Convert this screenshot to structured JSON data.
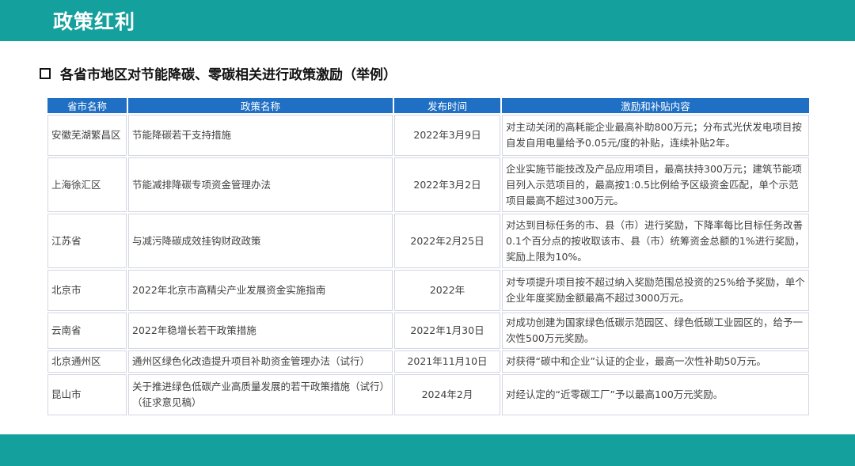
{
  "header": {
    "title": "政策红利"
  },
  "subtitle": "各省市地区对节能降碳、零碳相关进行政策激励（举例）",
  "table": {
    "columns": [
      "省市名称",
      "政策名称",
      "发布时间",
      "激励和补贴内容"
    ],
    "rows": [
      {
        "region": "安徽芜湖繁昌区",
        "policy": "节能降碳若干支持措施",
        "date": "2022年3月9日",
        "detail": "对主动关闭的高耗能企业最高补助800万元；分布式光伏发电项目按自发自用电量给予0.05元/度的补贴，连续补贴2年。"
      },
      {
        "region": "上海徐汇区",
        "policy": "节能减排降碳专项资金管理办法",
        "date": "2022年3月2日",
        "detail": "企业实施节能技改及产品应用项目，最高扶持300万元；建筑节能项目列入示范项目的，最高按1:0.5比例给予区级资金匹配，单个示范项目最高不超过300万元。"
      },
      {
        "region": "江苏省",
        "policy": "与减污降碳成效挂钩财政政策",
        "date": "2022年2月25日",
        "detail": "对达到目标任务的市、县（市）进行奖励，下降率每比目标任务改善0.1个百分点的按收取该市、县（市）统筹资金总额的1%进行奖励，奖励上限为10%。"
      },
      {
        "region": "北京市",
        "policy": "2022年北京市高精尖产业发展资金实施指南",
        "date": "2022年",
        "detail": "对专项提升项目按不超过纳入奖励范围总投资的25%给予奖励，单个企业年度奖励金额最高不超过3000万元。"
      },
      {
        "region": "云南省",
        "policy": "2022年稳增长若干政策措施",
        "date": "2022年1月30日",
        "detail": "对成功创建为国家绿色低碳示范园区、绿色低碳工业园区的，给予一次性500万元奖励。"
      },
      {
        "region": "北京通州区",
        "policy": "通州区绿色化改造提升项目补助资金管理办法（试行）",
        "date": "2021年11月10日",
        "detail": "对获得“碳中和企业”认证的企业，最高一次性补助50万元。"
      },
      {
        "region": "昆山市",
        "policy": "关于推进绿色低碳产业高质量发展的若干政策措施（试行）（征求意见稿）",
        "date": "2024年2月",
        "detail": "对经认定的“近零碳工厂”予以最高100万元奖励。"
      }
    ]
  }
}
